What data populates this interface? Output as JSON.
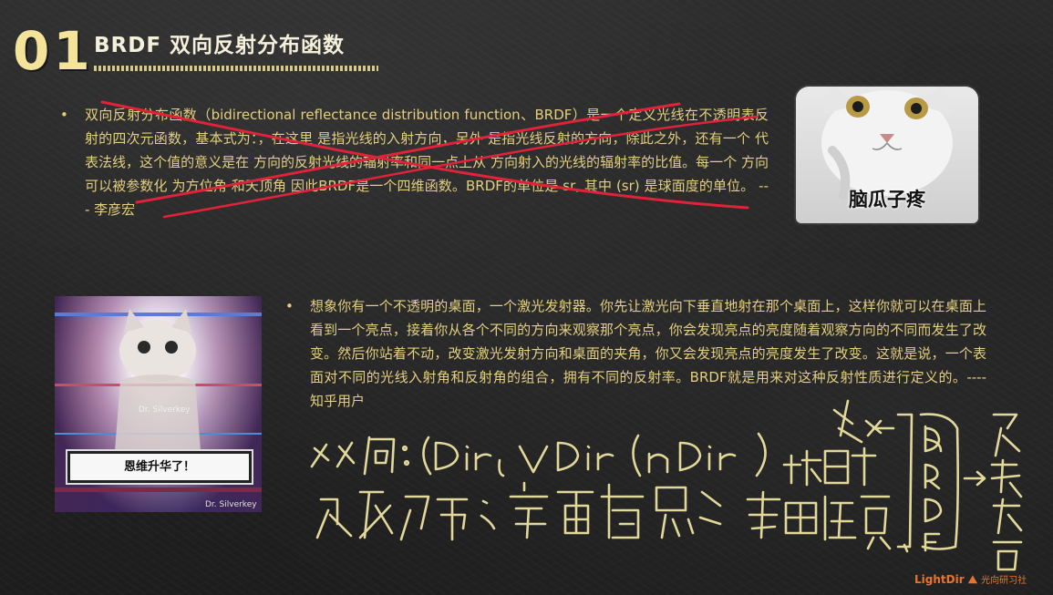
{
  "header": {
    "section_number": "01",
    "title": "BRDF 双向反射分布函数"
  },
  "paragraphs": [
    {
      "bullet": "•",
      "text": "双向反射分布函数（bidirectional reflectance distribution function、BRDF）是一个定义光线在不透明表反射的四次元函数，基本式为：，在这里 是指光线的入射方向，另外 是指光线反射的方向，除此之外，还有一个 代表法线，这个值的意义是在 方向的反射光线的辐射率和同一点上从 方向射入的光线的辐射率的比值。每一个 方向可以被参数化 为方位角 和天顶角 因此BRDF是一个四维函数。BRDF的单位是 sr, 其中 (sr) 是球面度的单位。 --- 李彦宏"
    },
    {
      "bullet": "•",
      "text": "想象你有一个不透明的桌面，一个激光发射器。你先让激光向下垂直地射在那个桌面上，这样你就可以在桌面上看到一个亮点，接着你从各个不同的方向来观察那个亮点，你会发现亮点的亮度随着观察方向的不同而发生了改变。然后你站着不动，改变激光发射方向和桌面的夹角，你又会发现亮点的亮度发生了改变。这就是说，一个表面对不同的光线入射角和反射角的组合，拥有不同的反射率。BRDF就是用来对这种反射性质进行定义的。---- 知乎用户"
    }
  ],
  "images": {
    "cat_meme_caption": "脑瓜子疼",
    "ascend_meme_caption": "恩维升华了！",
    "ascend_meme_watermark_mid": "Dr. Silverkey",
    "ascend_meme_watermark_bottom": "Dr. Silverkey"
  },
  "logo": {
    "brand": "LightDir",
    "suffix": "光向研习社"
  },
  "colors": {
    "background": "#222222",
    "text": "#e3cf7f",
    "strike": "#e0233a",
    "chalk": "#e2d89a",
    "logo": "#e8742a"
  }
}
